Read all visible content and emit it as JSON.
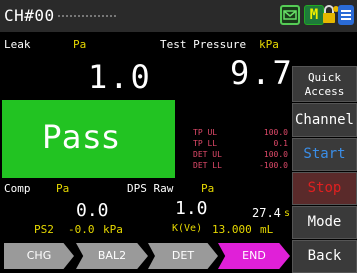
{
  "header": {
    "channel": "CH#00",
    "icons": [
      "mail-icon",
      "m-icon",
      "lock-key-icon",
      "menu-icon"
    ]
  },
  "leak": {
    "label": "Leak",
    "unit": "Pa",
    "value": "1.0"
  },
  "test_pressure": {
    "label": "Test Pressure",
    "unit": "kPa",
    "value": "9.7"
  },
  "result": {
    "label": "Pass",
    "color": "#22c322"
  },
  "limits": [
    {
      "name": "TP UL",
      "value": "100.0"
    },
    {
      "name": "TP LL",
      "value": "0.1"
    },
    {
      "name": "DET UL",
      "value": "100.0"
    },
    {
      "name": "DET LL",
      "value": "-100.0"
    }
  ],
  "comp": {
    "label": "Comp",
    "unit": "Pa",
    "value": "0.0"
  },
  "dps_raw": {
    "label": "DPS Raw",
    "unit": "Pa",
    "value": "1.0"
  },
  "time": {
    "value": "27.4",
    "unit": "s"
  },
  "ps2": {
    "label": "PS2",
    "value": "-0.0",
    "unit": "kPa"
  },
  "kve": {
    "label": "K(Ve)",
    "value": "13.000",
    "unit": "mL"
  },
  "side_buttons": {
    "quick_access_line1": "Quick",
    "quick_access_line2": "Access",
    "channel": "Channel",
    "start": "Start",
    "stop": "Stop",
    "mode": "Mode",
    "back": "Back"
  },
  "process": [
    "CHG",
    "BAL2",
    "DET",
    "END"
  ],
  "colors": {
    "pass_green": "#22c322",
    "label_yellow": "#e6d800",
    "limit_pink": "#e04a6a",
    "start_blue": "#3a8ee8",
    "stop_red": "#e02020",
    "end_magenta": "#e020d8"
  }
}
